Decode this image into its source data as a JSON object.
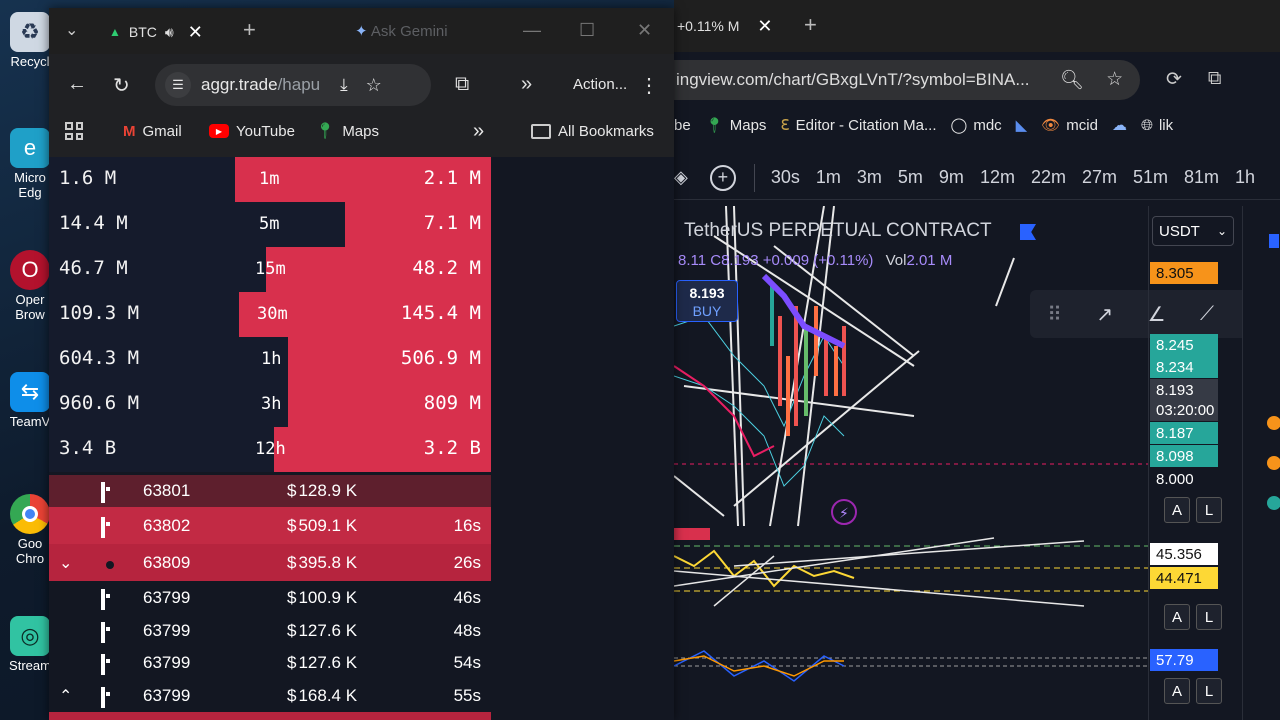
{
  "desktop": {
    "icons": [
      {
        "label": "Recycl",
        "icon": "recycle-bin-icon"
      },
      {
        "label": "Micro Edg",
        "icon": "edge-icon"
      },
      {
        "label": "Oper Brow",
        "icon": "opera-icon"
      },
      {
        "label": "TeamV",
        "icon": "teamviewer-icon"
      },
      {
        "label": "Goo Chro",
        "icon": "chrome-icon"
      },
      {
        "label": "Stream",
        "icon": "streamlabs-icon"
      }
    ]
  },
  "left_browser": {
    "tab_title": "BTC",
    "gemini_label": "Ask Gemini",
    "url_host": "aggr.trade",
    "url_path": "/hapu",
    "action_label": "Action...",
    "bookmarks": [
      {
        "label": "Gmail",
        "icon": "gmail-icon"
      },
      {
        "label": "YouTube",
        "icon": "youtube-icon"
      },
      {
        "label": "Maps",
        "icon": "maps-icon"
      }
    ],
    "all_bookmarks_label": "All Bookmarks",
    "stats": [
      {
        "left": "1.6 M",
        "period": "1m",
        "right": "2.1 M",
        "red_fraction": 0.58
      },
      {
        "left": "14.4 M",
        "period": "5m",
        "right": "7.1 M",
        "red_fraction": 0.33
      },
      {
        "left": "46.7 M",
        "period": "15m",
        "right": "48.2 M",
        "red_fraction": 0.51
      },
      {
        "left": "109.3 M",
        "period": "30m",
        "right": "145.4 M",
        "red_fraction": 0.57
      },
      {
        "left": "604.3 M",
        "period": "1h",
        "right": "506.9 M",
        "red_fraction": 0.46
      },
      {
        "left": "960.6 M",
        "period": "3h",
        "right": "809 M",
        "red_fraction": 0.46
      },
      {
        "left": "3.4 B",
        "period": "12h",
        "right": "3.2 B",
        "red_fraction": 0.49
      }
    ],
    "trades": [
      {
        "arrow": "",
        "price": "63801",
        "amount": "128.9 K",
        "time": "",
        "exchange": "binance-icon",
        "bg": "#5e1f2d"
      },
      {
        "arrow": "",
        "price": "63802",
        "amount": "509.1 K",
        "time": "16s",
        "exchange": "binance-icon",
        "bg": "#c22a44"
      },
      {
        "arrow": "⌄",
        "price": "63809",
        "amount": "395.8 K",
        "time": "26s",
        "exchange": "bybit-icon",
        "bg": "#b6243e"
      },
      {
        "arrow": "",
        "price": "63799",
        "amount": "100.9 K",
        "time": "46s",
        "exchange": "binance-icon",
        "bg": "#131722"
      },
      {
        "arrow": "",
        "price": "63799",
        "amount": "127.6 K",
        "time": "48s",
        "exchange": "binance-icon",
        "bg": "#131722"
      },
      {
        "arrow": "",
        "price": "63799",
        "amount": "127.6 K",
        "time": "54s",
        "exchange": "binance-icon",
        "bg": "#131722"
      },
      {
        "arrow": "⌃",
        "price": "63799",
        "amount": "168.4 K",
        "time": "55s",
        "exchange": "binance-icon",
        "bg": "#131722"
      }
    ],
    "currency_symbol": "$"
  },
  "right_browser": {
    "tab_title": "+0.11% M",
    "url": "ingview.com/chart/GBxgLVnT/?symbol=BINA...",
    "bookmarks": [
      "be",
      "Maps",
      "Editor - Citation Ma...",
      "mdc",
      "",
      "mcid",
      "",
      "lik"
    ],
    "intervals": [
      "30s",
      "1m",
      "3m",
      "5m",
      "9m",
      "12m",
      "22m",
      "27m",
      "51m",
      "81m",
      "1h"
    ],
    "symbol_title": "TetherUS PERPETUAL CONTRACT",
    "ohlc": "8.11 C8.193 +0.009 (+0.11%)",
    "vol_label": "Vol",
    "vol_value": "2.01 M",
    "buy_price": "8.193",
    "buy_label": "BUY",
    "currency": "USDT",
    "price_tags": [
      {
        "value": "8.305",
        "color": "#f7931a"
      },
      {
        "value": "8.245",
        "color": "#26a69a"
      },
      {
        "value": "8.234",
        "color": "#26a69a"
      },
      {
        "value": "8.193",
        "color": "#363a45"
      },
      {
        "value": "03:20:00",
        "color": "#363a45"
      },
      {
        "value": "8.187",
        "color": "#26a69a"
      },
      {
        "value": "8.098",
        "color": "#26a69a"
      },
      {
        "value": "8.000",
        "color": "#131722"
      },
      {
        "value": "45.356",
        "color": "#ffffff"
      },
      {
        "value": "44.471",
        "color": "#fdd835"
      },
      {
        "value": "57.79",
        "color": "#2962ff"
      }
    ],
    "al_buttons": [
      "A",
      "L"
    ]
  }
}
